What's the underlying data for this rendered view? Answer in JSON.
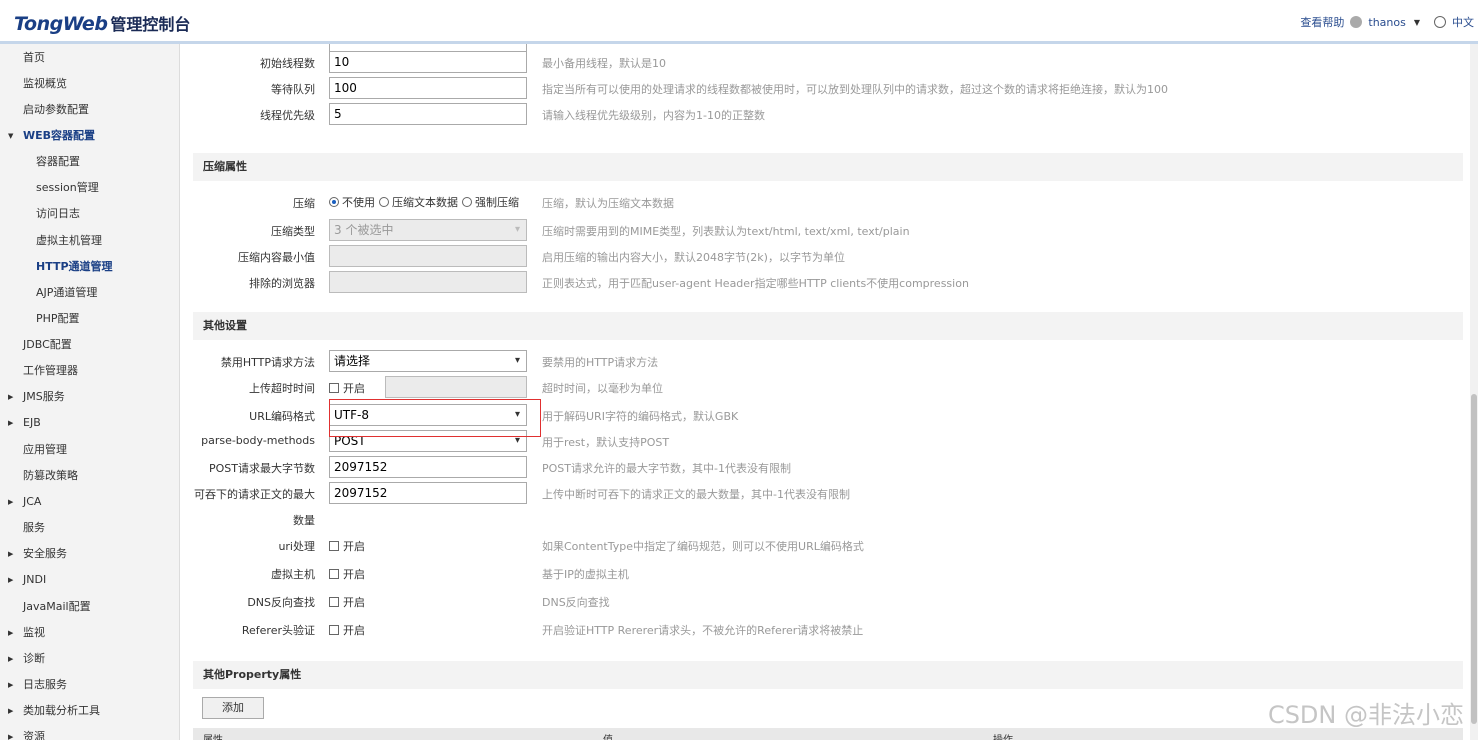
{
  "header": {
    "brand": "TongWeb",
    "suffix": "管理控制台",
    "help": "查看帮助",
    "user": "thanos",
    "language": "中文"
  },
  "sidebar": {
    "items": [
      {
        "label": "首页",
        "level": 1,
        "top": 0
      },
      {
        "label": "监视概览",
        "level": 1
      },
      {
        "label": "启动参数配置",
        "level": 1
      },
      {
        "label": "WEB容器配置",
        "level": 1,
        "expanded": true,
        "active": true
      },
      {
        "label": "容器配置",
        "level": 2
      },
      {
        "label": "session管理",
        "level": 2
      },
      {
        "label": "访问日志",
        "level": 2
      },
      {
        "label": "虚拟主机管理",
        "level": 2
      },
      {
        "label": "HTTP通道管理",
        "level": 2,
        "active": true
      },
      {
        "label": "AJP通道管理",
        "level": 2
      },
      {
        "label": "PHP配置",
        "level": 2
      },
      {
        "label": "JDBC配置",
        "level": 1
      },
      {
        "label": "工作管理器",
        "level": 1
      },
      {
        "label": "JMS服务",
        "level": 1,
        "collapsed": true
      },
      {
        "label": "EJB",
        "level": 1,
        "collapsed": true
      },
      {
        "label": "应用管理",
        "level": 1
      },
      {
        "label": "防篡改策略",
        "level": 1
      },
      {
        "label": "JCA",
        "level": 1,
        "collapsed": true
      },
      {
        "label": "服务",
        "level": 1
      },
      {
        "label": "安全服务",
        "level": 1,
        "collapsed": true
      },
      {
        "label": "JNDI",
        "level": 1,
        "collapsed": true
      },
      {
        "label": "JavaMail配置",
        "level": 1
      },
      {
        "label": "监视",
        "level": 1,
        "collapsed": true
      },
      {
        "label": "诊断",
        "level": 1,
        "collapsed": true
      },
      {
        "label": "日志服务",
        "level": 1,
        "collapsed": true
      },
      {
        "label": "类加载分析工具",
        "level": 1,
        "collapsed": true
      },
      {
        "label": "资源",
        "level": 1,
        "collapsed": true
      }
    ]
  },
  "thread": {
    "init_label": "初始线程数",
    "init_value": "10",
    "init_hint": "最小备用线程，默认是10",
    "queue_label": "等待队列",
    "queue_value": "100",
    "queue_hint": "指定当所有可以使用的处理请求的线程数都被使用时，可以放到处理队列中的请求数，超过这个数的请求将拒绝连接，默认为100",
    "prio_label": "线程优先级",
    "prio_value": "5",
    "prio_hint": "请输入线程优先级级别，内容为1-10的正整数"
  },
  "compression": {
    "title": "压缩属性",
    "mode_label": "压缩",
    "mode_options": [
      "不使用",
      "压缩文本数据",
      "强制压缩"
    ],
    "mode_selected": "不使用",
    "mode_hint": "压缩，默认为压缩文本数据",
    "type_label": "压缩类型",
    "type_value": "3 个被选中",
    "type_hint": "压缩时需要用到的MIME类型，列表默认为text/html, text/xml, text/plain",
    "min_label": "压缩内容最小值",
    "min_hint": "启用压缩的输出内容大小，默认2048字节(2k)，以字节为单位",
    "exclude_label": "排除的浏览器",
    "exclude_hint": "正则表达式，用于匹配user-agent Header指定哪些HTTP clients不使用compression"
  },
  "other": {
    "title": "其他设置",
    "disable_method_label": "禁用HTTP请求方法",
    "disable_method_value": "请选择",
    "disable_method_hint": "要禁用的HTTP请求方法",
    "upload_timeout_label": "上传超时时间",
    "upload_timeout_check": "开启",
    "upload_timeout_hint": "超时时间，以毫秒为单位",
    "url_encoding_label": "URL编码格式",
    "url_encoding_value": "UTF-8",
    "url_encoding_hint": "用于解码URI字符的编码格式，默认GBK",
    "parse_body_label": "parse-body-methods",
    "parse_body_value": "POST",
    "parse_body_hint": "用于rest，默认支持POST",
    "post_max_label": "POST请求最大字节数",
    "post_max_value": "2097152",
    "post_max_hint": "POST请求允许的最大字节数，其中-1代表没有限制",
    "swallow_label_1": "可吞下的请求正文的最大",
    "swallow_label_2": "数量",
    "swallow_value": "2097152",
    "swallow_hint": "上传中断时可吞下的请求正文的最大数量，其中-1代表没有限制",
    "uri_label": "uri处理",
    "uri_check": "开启",
    "uri_hint": "如果ContentType中指定了编码规范，则可以不使用URL编码格式",
    "vhost_label": "虚拟主机",
    "vhost_check": "开启",
    "vhost_hint": "基于IP的虚拟主机",
    "dns_label": "DNS反向查找",
    "dns_check": "开启",
    "dns_hint": "DNS反向查找",
    "referer_label": "Referer头验证",
    "referer_check": "开启",
    "referer_hint": "开启验证HTTP Rererer请求头，不被允许的Referer请求将被禁止"
  },
  "property": {
    "title": "其他Property属性",
    "add_label": "添加",
    "col_name": "属性",
    "col_value": "值",
    "col_op": "操作"
  },
  "watermark": "CSDN @非法小恋"
}
